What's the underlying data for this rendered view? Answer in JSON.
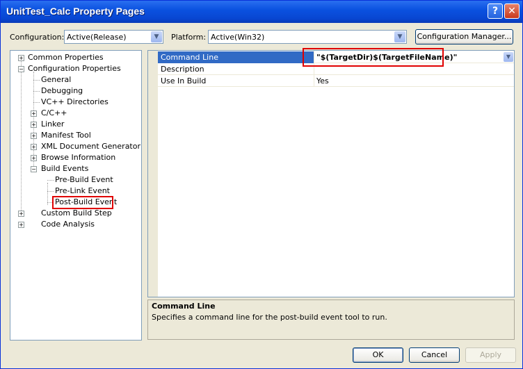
{
  "window": {
    "title": "UnitTest_Calc Property Pages",
    "help_glyph": "?",
    "close_glyph": "✕"
  },
  "toolbar": {
    "configuration_label": "Configuration:",
    "configuration_value": "Active(Release)",
    "platform_label": "Platform:",
    "platform_value": "Active(Win32)",
    "config_manager_label": "Configuration Manager..."
  },
  "tree": {
    "items": [
      {
        "label": "Common Properties",
        "expander": "+"
      },
      {
        "label": "Configuration Properties",
        "expander": "−"
      },
      {
        "label": "General"
      },
      {
        "label": "Debugging"
      },
      {
        "label": "VC++ Directories"
      },
      {
        "label": "C/C++",
        "expander": "+"
      },
      {
        "label": "Linker",
        "expander": "+"
      },
      {
        "label": "Manifest Tool",
        "expander": "+"
      },
      {
        "label": "XML Document Generator",
        "expander": "+"
      },
      {
        "label": "Browse Information",
        "expander": "+"
      },
      {
        "label": "Build Events",
        "expander": "−"
      },
      {
        "label": "Pre-Build Event"
      },
      {
        "label": "Pre-Link Event"
      },
      {
        "label": "Post-Build Event",
        "selected": true
      },
      {
        "label": "Custom Build Step",
        "expander": "+"
      },
      {
        "label": "Code Analysis",
        "expander": "+"
      }
    ]
  },
  "grid": {
    "rows": [
      {
        "name": "Command Line",
        "value": "\"$(TargetDir)$(TargetFileName)\"",
        "selected": true
      },
      {
        "name": "Description",
        "value": ""
      },
      {
        "name": "Use In Build",
        "value": "Yes"
      }
    ]
  },
  "description": {
    "title": "Command Line",
    "text": "Specifies a command line for the post-build event tool to run."
  },
  "buttons": {
    "ok": "OK",
    "cancel": "Cancel",
    "apply": "Apply"
  },
  "colors": {
    "selection": "#316ac5",
    "highlight_box": "#e00000",
    "title_bar": "#0b52e0"
  }
}
